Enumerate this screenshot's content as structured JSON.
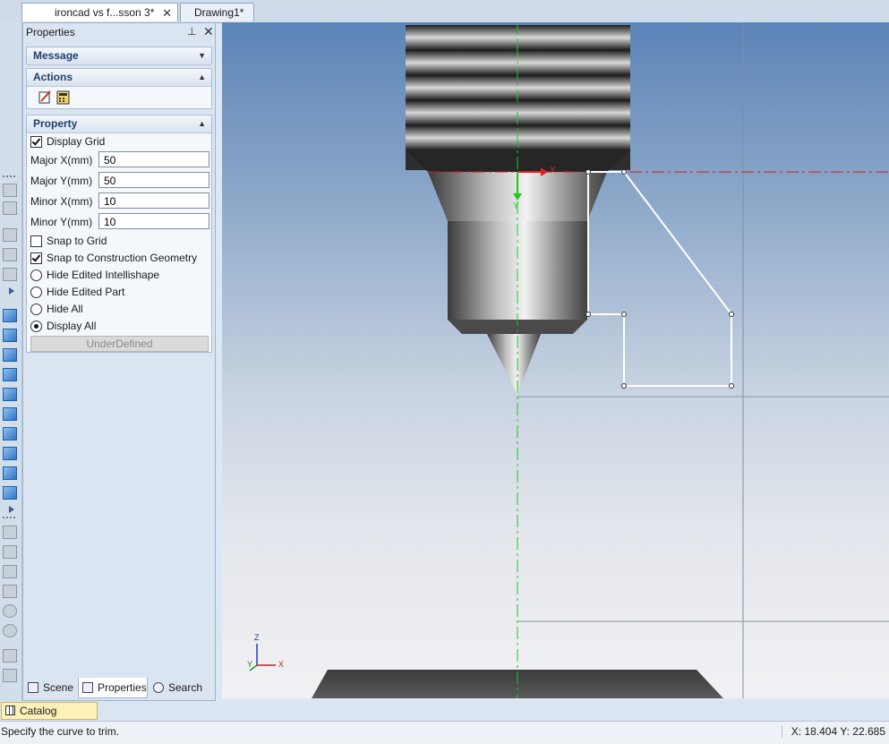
{
  "document_tabs": [
    {
      "label": "ironcad vs f...sson 3*",
      "active": true
    },
    {
      "label": "Drawing1*",
      "active": false
    }
  ],
  "panel": {
    "title": "Properties",
    "sections": {
      "message": "Message",
      "actions": "Actions",
      "property": "Property"
    },
    "display_grid": {
      "label": "Display Grid",
      "checked": true
    },
    "fields": [
      {
        "label": "Major X(mm)",
        "value": "50"
      },
      {
        "label": "Major Y(mm)",
        "value": "50"
      },
      {
        "label": "Minor X(mm)",
        "value": "10"
      },
      {
        "label": "Minor Y(mm)",
        "value": "10"
      }
    ],
    "snap_to_grid": {
      "label": "Snap to Grid",
      "checked": false
    },
    "snap_to_construction": {
      "label": "Snap to Construction Geometry",
      "checked": true
    },
    "radios": [
      {
        "label": "Hide Edited Intellishape",
        "selected": false
      },
      {
        "label": "Hide Edited Part",
        "selected": false
      },
      {
        "label": "Hide All",
        "selected": false
      },
      {
        "label": "Display All",
        "selected": true
      }
    ],
    "status_button": "UnderDefined"
  },
  "panel_tabs": [
    {
      "label": "Scene",
      "icon": "scene-icon"
    },
    {
      "label": "Properties",
      "icon": "properties-icon"
    },
    {
      "label": "Search",
      "icon": "search-icon"
    }
  ],
  "viewport": {
    "axis_labels": {
      "x": "X",
      "y": "Y",
      "z": "Z"
    },
    "colors": {
      "x_axis": "#e02020",
      "y_axis": "#20c020",
      "sketch": "#ffffff"
    }
  },
  "catalog_browser": "Catalog Browser",
  "status": {
    "message": "Specify the curve to trim.",
    "coordinates": "X: 18.404 Y: 22.685"
  }
}
